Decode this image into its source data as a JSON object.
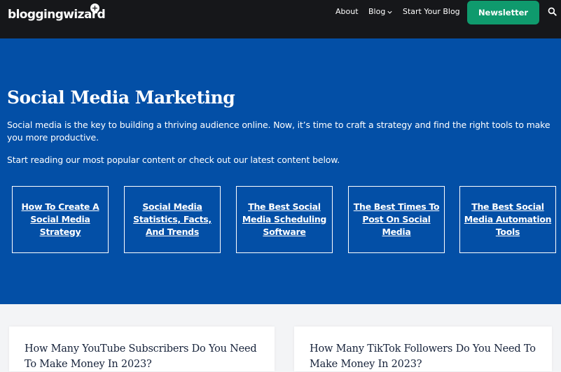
{
  "header": {
    "logo_text": "bloggingwizard",
    "logo_mark": "+",
    "nav": {
      "about": "About",
      "blog": "Blog",
      "start_blog": "Start Your Blog"
    },
    "newsletter_label": "Newsletter",
    "icons": {
      "blog_dropdown": "chevron-down-icon",
      "search": "search-icon"
    }
  },
  "hero": {
    "title": "Social Media Marketing",
    "description": "Social media is the key to building a thriving audience online. Now, it’s time to craft a strategy and find the right tools to make you more productive.",
    "cta_text": "Start reading our most popular content or check out our latest content below.",
    "cards": [
      {
        "label": "How To Create A Social Media Strategy"
      },
      {
        "label": "Social Media Statistics, Facts, And Trends"
      },
      {
        "label": "The Best Social Media Scheduling Software"
      },
      {
        "label": "The Best Times To Post On Social Media"
      },
      {
        "label": "The Best Social Media Automation Tools"
      }
    ]
  },
  "articles": [
    {
      "title": "How Many YouTube Subscribers Do You Need To Make Money In 2023?"
    },
    {
      "title": "How Many TikTok Followers Do You Need To Make Money In 2023?"
    }
  ],
  "colors": {
    "header_bg": "#16171a",
    "hero_bg": "#034fa6",
    "newsletter_bg": "#0f9a6d",
    "page_bg": "#f3f4f6",
    "article_title": "#16223a"
  }
}
